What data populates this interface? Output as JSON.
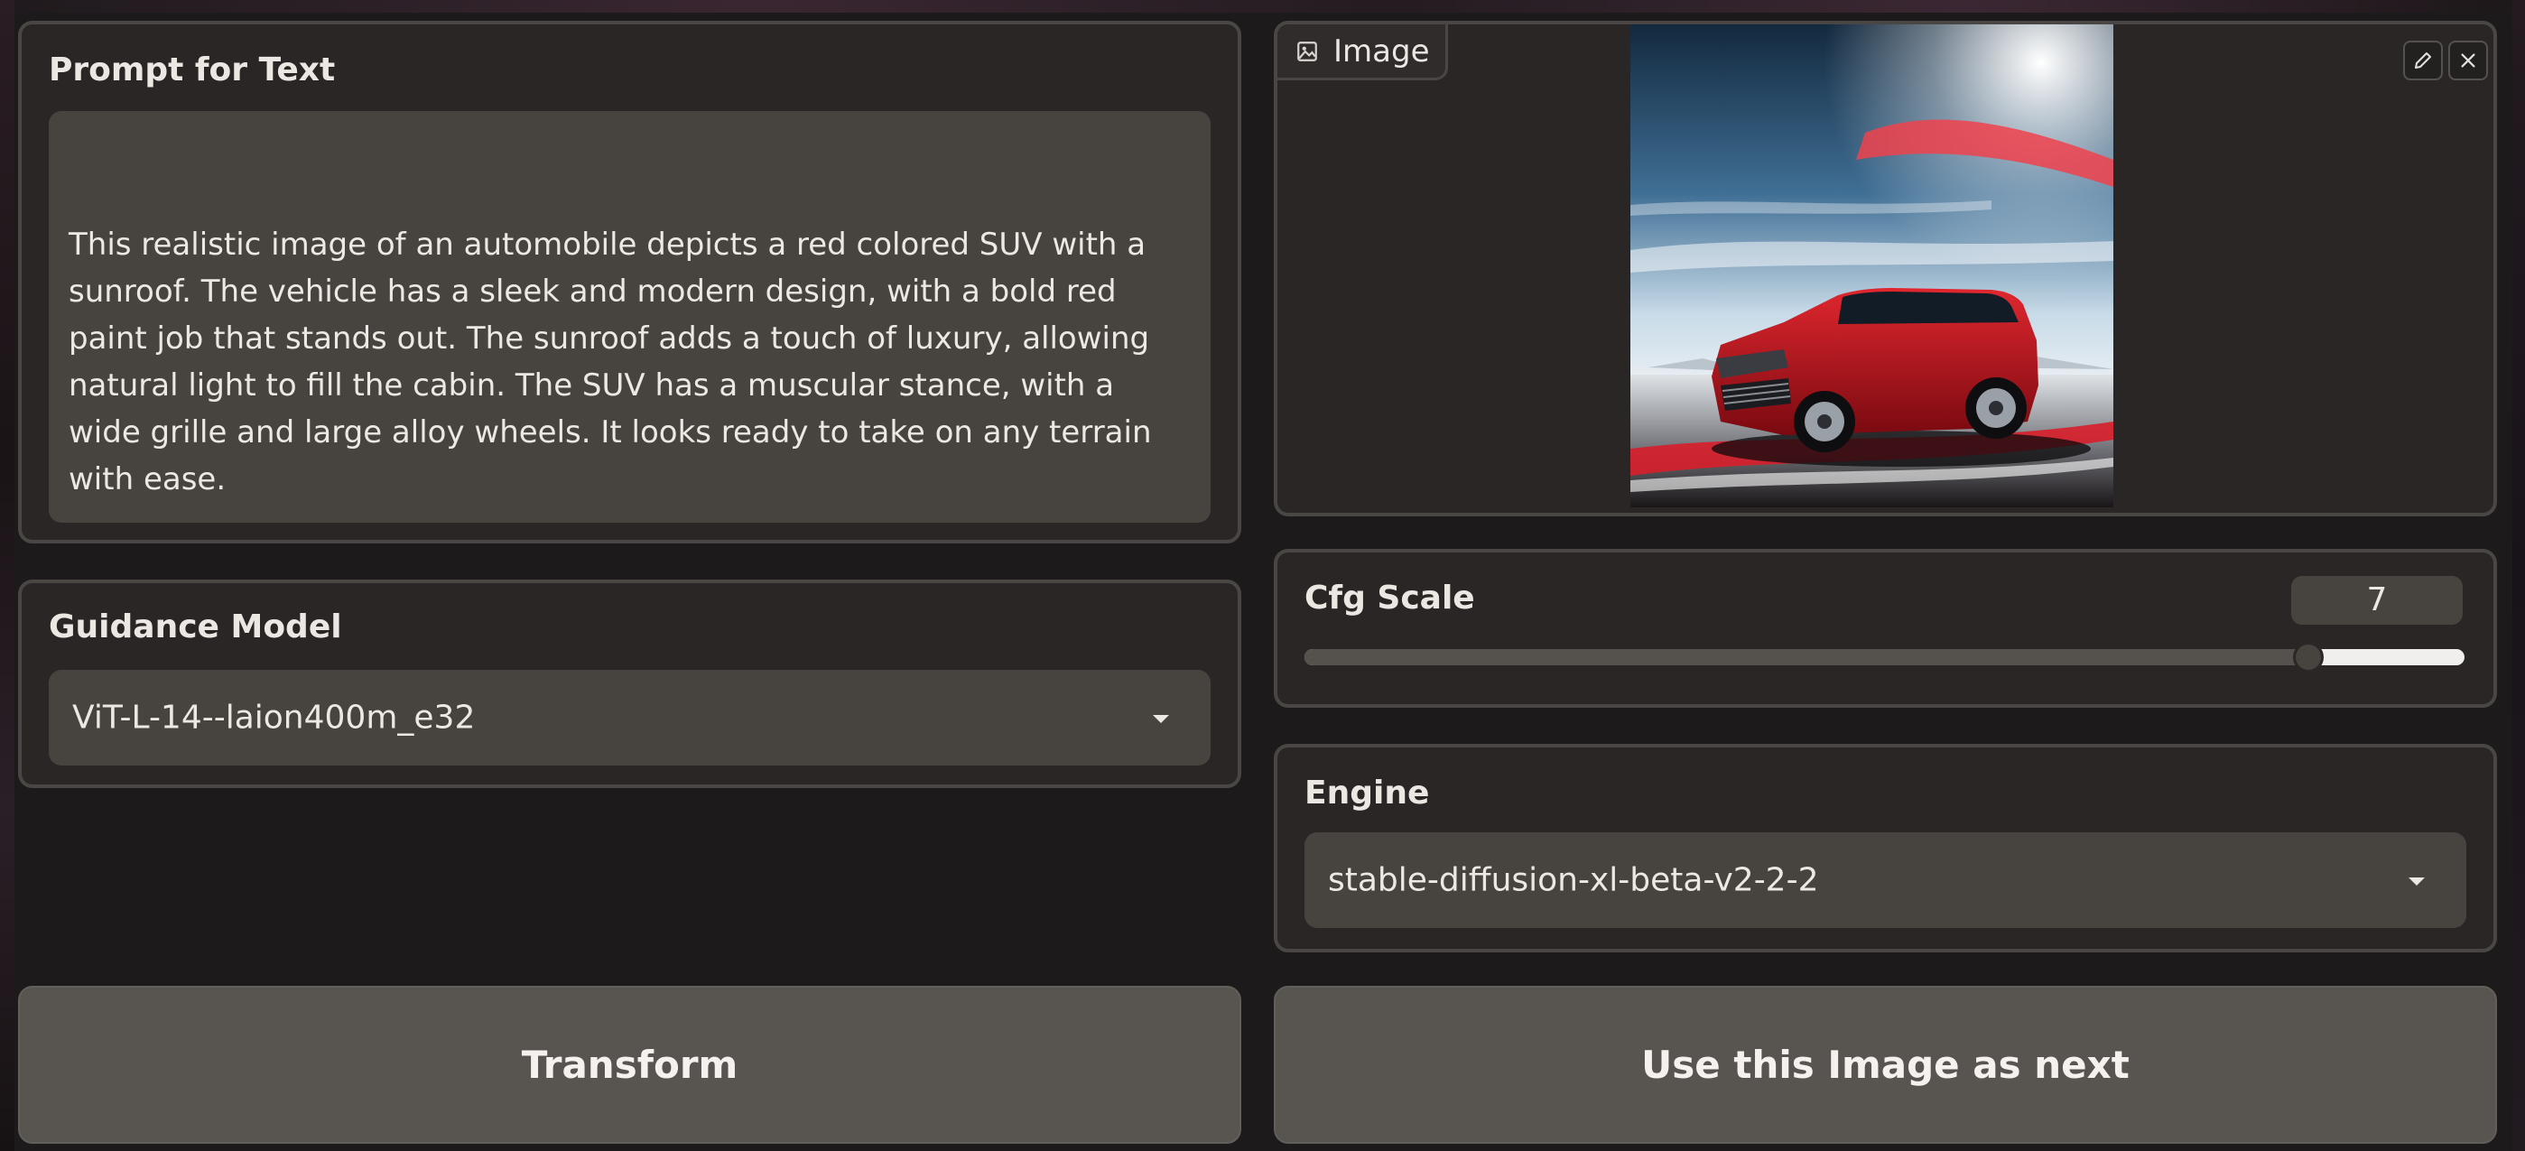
{
  "prompt": {
    "label": "Prompt for Text",
    "value": "This realistic image of an automobile depicts a red colored SUV with a sunroof. The vehicle has a sleek and modern design, with a bold red paint job that stands out. The sunroof adds a touch of luxury, allowing natural light to fill the cabin. The SUV has a muscular stance, with a wide grille and large alloy wheels. It looks ready to take on any terrain with ease."
  },
  "guidance_model": {
    "label": "Guidance Model",
    "selected": "ViT-L-14--laion400m_e32"
  },
  "image_output": {
    "label": "Image",
    "icons": [
      "image-icon",
      "pencil-icon",
      "close-icon"
    ]
  },
  "cfg_scale": {
    "label": "Cfg Scale",
    "value": "7",
    "slider_fraction": 0.865
  },
  "engine": {
    "label": "Engine",
    "selected": "stable-diffusion-xl-beta-v2-2-2"
  },
  "buttons": {
    "transform": "Transform",
    "use_next": "Use this Image as next"
  },
  "colors": {
    "panel_bg": "#292625",
    "panel_border": "#4a4644",
    "field_bg": "#47433f",
    "button_bg": "#58544f",
    "accent_red": "#c8121c"
  }
}
